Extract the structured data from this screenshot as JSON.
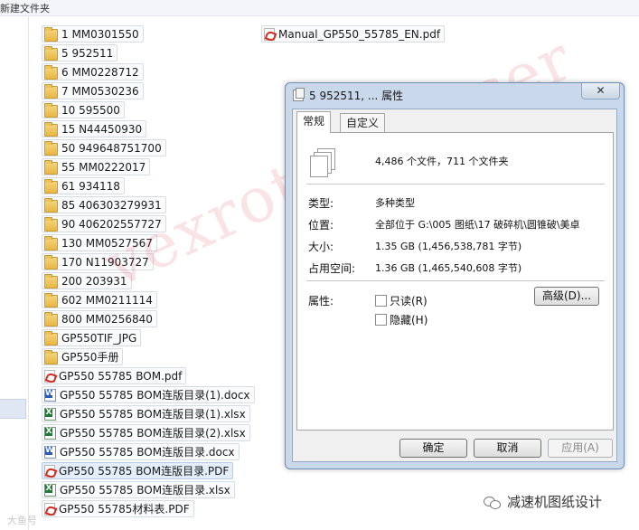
{
  "window": {
    "title": "新建文件夹"
  },
  "files": [
    {
      "name": "1 MM0301550",
      "type": "folder",
      "selected": false
    },
    {
      "name": "5 952511",
      "type": "folder",
      "selected": false
    },
    {
      "name": "6 MM0228712",
      "type": "folder",
      "selected": false
    },
    {
      "name": "7 MM0530236",
      "type": "folder",
      "selected": false
    },
    {
      "name": "10 595500",
      "type": "folder",
      "selected": false
    },
    {
      "name": "15 N44450930",
      "type": "folder",
      "selected": false
    },
    {
      "name": "50 949648751700",
      "type": "folder",
      "selected": false
    },
    {
      "name": "55 MM0222017",
      "type": "folder",
      "selected": false
    },
    {
      "name": "61 934118",
      "type": "folder",
      "selected": false
    },
    {
      "name": "85 406303279931",
      "type": "folder",
      "selected": false
    },
    {
      "name": "90  406202557727",
      "type": "folder",
      "selected": false
    },
    {
      "name": "130 MM0527567",
      "type": "folder",
      "selected": false
    },
    {
      "name": "170 N11903727",
      "type": "folder",
      "selected": false
    },
    {
      "name": "200 203931",
      "type": "folder",
      "selected": false
    },
    {
      "name": "602 MM0211114",
      "type": "folder",
      "selected": false
    },
    {
      "name": "800 MM0256840",
      "type": "folder",
      "selected": false
    },
    {
      "name": "GP550TIF_JPG",
      "type": "folder",
      "selected": false
    },
    {
      "name": "GP550手册",
      "type": "folder",
      "selected": false
    },
    {
      "name": "GP550 55785 BOM.pdf",
      "type": "pdf",
      "selected": false
    },
    {
      "name": "GP550 55785 BOM连版目录(1).docx",
      "type": "word",
      "selected": false
    },
    {
      "name": "GP550 55785 BOM连版目录(1).xlsx",
      "type": "excel",
      "selected": false
    },
    {
      "name": "GP550 55785 BOM连版目录(2).xlsx",
      "type": "excel",
      "selected": false
    },
    {
      "name": "GP550 55785 BOM连版目录.docx",
      "type": "word",
      "selected": false
    },
    {
      "name": "GP550 55785 BOM连版目录.PDF",
      "type": "pdf",
      "selected": true
    },
    {
      "name": "GP550 55785 BOM连版目录.xlsx",
      "type": "excel",
      "selected": false
    },
    {
      "name": "GP550 55785材料表.PDF",
      "type": "pdf",
      "selected": false
    }
  ],
  "second_column_files": [
    {
      "name": "Manual_GP550_55785_EN.pdf",
      "type": "pdf"
    }
  ],
  "dialog": {
    "title": "5 952511, ... 属性",
    "close_symbol": "✕",
    "tabs": [
      {
        "label": "常规",
        "active": true
      },
      {
        "label": "自定义",
        "active": false
      }
    ],
    "summary": "4,486 个文件，711 个文件夹",
    "props": [
      {
        "label": "类型:",
        "value": "多种类型"
      },
      {
        "label": "位置:",
        "value": "全部位于 G:\\005 图纸\\17 破碎机\\圆锥破\\美卓"
      },
      {
        "label": "大小:",
        "value": "1.35 GB (1,456,538,781 字节)"
      },
      {
        "label": "占用空间:",
        "value": "1.36 GB (1,465,540,608 字节)"
      }
    ],
    "attributes_label": "属性:",
    "readonly_label": "只读(R)",
    "hidden_label": "隐藏(H)",
    "advanced_button": "高级(D)...",
    "ok_button": "确定",
    "cancel_button": "取消",
    "apply_button": "应用(A)"
  },
  "overlay": {
    "watermark": "vexrothreducer",
    "brand": "减速机图纸设计",
    "corner_logo": "大鱼号"
  },
  "colors": {
    "selection": "#e4eefb",
    "dialog_frame": "#c9d8ea",
    "watermark": "#d73c46"
  }
}
